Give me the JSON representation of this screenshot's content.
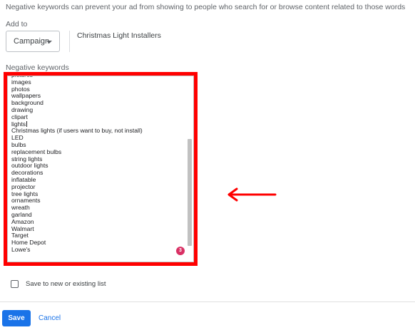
{
  "hint_text": "Negative keywords can prevent your ad from showing to people who search for or browse content related to those words",
  "add_to": {
    "label": "Add to",
    "selected": "Campaign",
    "campaign_name": "Christmas Light Installers"
  },
  "keywords": {
    "label": "Negative keywords",
    "lines": [
      "pictures",
      "images",
      "photos",
      "wallpapers",
      "background",
      "drawing",
      "clipart",
      "lights",
      "Christmas lights (if users want to buy, not install)",
      "LED",
      "bulbs",
      "replacement bulbs",
      "string lights",
      "outdoor lights",
      "decorations",
      "inflatable",
      "projector",
      "tree lights",
      "ornaments",
      "wreath",
      "garland",
      "Amazon",
      "Walmart",
      "Target",
      "Home Depot",
      "Lowe's"
    ],
    "error_count": "3"
  },
  "save_to_list": {
    "label": "Save to new or existing list",
    "checked": false
  },
  "actions": {
    "save_label": "Save",
    "cancel_label": "Cancel"
  },
  "colors": {
    "highlight": "#ff0000",
    "primary": "#1a73e8",
    "error_badge": "#d93064"
  },
  "icons": [
    "dropdown-caret-icon",
    "red-arrow-annotation",
    "checkbox-icon"
  ]
}
